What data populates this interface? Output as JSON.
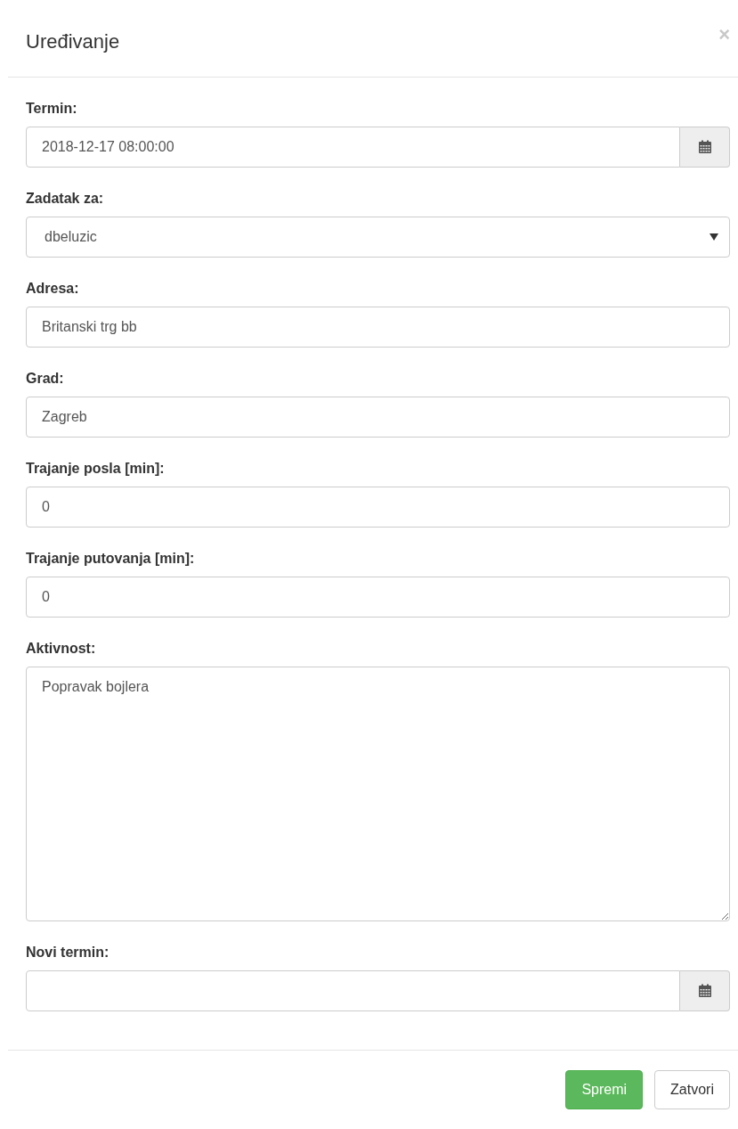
{
  "title": "Uređivanje",
  "close": "×",
  "fields": [
    {
      "kind": "date",
      "label": "Termin:",
      "value": "2018-12-17 08:00:00"
    },
    {
      "kind": "select",
      "label": "Zadatak za:",
      "value": "dbeluzic"
    },
    {
      "kind": "text",
      "label": "Adresa:",
      "value": "Britanski trg bb"
    },
    {
      "kind": "text",
      "label": "Grad:",
      "value": "Zagreb"
    },
    {
      "kind": "text",
      "label": "Trajanje posla [min]:",
      "value": "0"
    },
    {
      "kind": "text",
      "label": "Trajanje putovanja [min]:",
      "value": "0"
    },
    {
      "kind": "textarea",
      "label": "Aktivnost:",
      "value": "Popravak bojlera"
    },
    {
      "kind": "date",
      "label": "Novi termin:"
    }
  ],
  "buttons": [
    {
      "kind": "primary",
      "label": "Spremi"
    },
    {
      "kind": "default",
      "label": "Zatvori"
    }
  ]
}
